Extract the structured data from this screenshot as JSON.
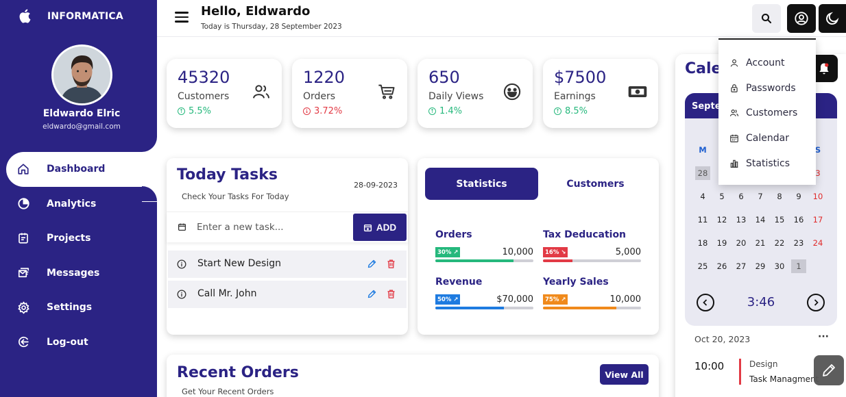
{
  "sidebar": {
    "brand": "INFORMATICA",
    "user": {
      "name": "Eldwardo Elric",
      "email": "eldwardo@gmail.com"
    },
    "items": [
      {
        "label": "Dashboard",
        "icon": "home-icon",
        "active": true
      },
      {
        "label": "Analytics",
        "icon": "pie-chart-icon"
      },
      {
        "label": "Projects",
        "icon": "clipboard-icon"
      },
      {
        "label": "Messages",
        "icon": "envelope-icon"
      },
      {
        "label": "Settings",
        "icon": "gear-icon"
      },
      {
        "label": "Log-out",
        "icon": "logout-icon"
      }
    ]
  },
  "header": {
    "greeting": "Hello, Eldwardo",
    "date_line": "Today is Thursday, 28 September 2023"
  },
  "stats": [
    {
      "value": "45320",
      "label": "Customers",
      "change": "5.5%",
      "trend": "up",
      "icon": "users-icon"
    },
    {
      "value": "1220",
      "label": "Orders",
      "change": "3.72%",
      "trend": "down",
      "icon": "cart-icon"
    },
    {
      "value": "650",
      "label": "Daily Views",
      "change": "1.4%",
      "trend": "up",
      "icon": "smiley-icon"
    },
    {
      "value": "$7500",
      "label": "Earnings",
      "change": "8.5%",
      "trend": "up",
      "icon": "money-icon"
    }
  ],
  "tasks": {
    "title": "Today Tasks",
    "date": "28-09-2023",
    "subtitle": "Check Your Tasks For Today",
    "input_placeholder": "Enter a new task...",
    "add_label": "ADD",
    "items": [
      "Start New Design",
      "Call Mr. John"
    ]
  },
  "statistics": {
    "tab_active": "Statistics",
    "tab_inactive": "Customers",
    "metrics": [
      {
        "title": "Orders",
        "badge": "30%",
        "value": "10,000",
        "progress": 0.8,
        "color": "#25b87c"
      },
      {
        "title": "Tax Deducation",
        "badge": "16%",
        "value": "5,000",
        "progress": 0.3,
        "color": "#e23a45"
      },
      {
        "title": "Revenue",
        "badge": "50%",
        "value": "$70,000",
        "progress": 0.7,
        "color": "#1e7be0"
      },
      {
        "title": "Yearly Sales",
        "badge": "75%",
        "value": "10,000",
        "progress": 0.75,
        "color": "#f08a1c"
      }
    ]
  },
  "recent_orders": {
    "title": "Recent Orders",
    "subtitle": "Get Your Recent Orders",
    "view_all": "View All"
  },
  "calendar": {
    "title": "Cale",
    "month_header": "Septer",
    "dow": [
      "M",
      "",
      "",
      "",
      "",
      "",
      "S"
    ],
    "rows": [
      [
        {
          "d": "28",
          "s": "grey"
        },
        {
          "d": ""
        },
        {
          "d": ""
        },
        {
          "d": ""
        },
        {
          "d": ""
        },
        {
          "d": ""
        },
        {
          "d": "3",
          "s": "red"
        }
      ],
      [
        {
          "d": "4"
        },
        {
          "d": "5"
        },
        {
          "d": "6"
        },
        {
          "d": "7"
        },
        {
          "d": "8"
        },
        {
          "d": "9"
        },
        {
          "d": "10",
          "s": "red"
        }
      ],
      [
        {
          "d": "11"
        },
        {
          "d": "12"
        },
        {
          "d": "13"
        },
        {
          "d": "14"
        },
        {
          "d": "15"
        },
        {
          "d": "16"
        },
        {
          "d": "17",
          "s": "red"
        }
      ],
      [
        {
          "d": "18"
        },
        {
          "d": "19"
        },
        {
          "d": "20"
        },
        {
          "d": "21"
        },
        {
          "d": "22"
        },
        {
          "d": "23"
        },
        {
          "d": "24",
          "s": "red"
        }
      ],
      [
        {
          "d": "25"
        },
        {
          "d": "26"
        },
        {
          "d": "27"
        },
        {
          "d": "28",
          "s": "today"
        },
        {
          "d": "29"
        },
        {
          "d": "30"
        },
        {
          "d": "1",
          "s": "grey"
        }
      ]
    ],
    "clock": "3:46",
    "event": {
      "date": "Oct 20, 2023",
      "more": "···",
      "time": "10:00",
      "category": "Design",
      "name": "Task Managment"
    }
  },
  "dropdown": [
    {
      "label": "Account",
      "icon": "user-icon"
    },
    {
      "label": "Passwords",
      "icon": "lock-icon"
    },
    {
      "label": "Customers",
      "icon": "customers-icon"
    },
    {
      "label": "Calendar",
      "icon": "calendar-icon"
    },
    {
      "label": "Statistics",
      "icon": "bar-chart-icon"
    }
  ]
}
